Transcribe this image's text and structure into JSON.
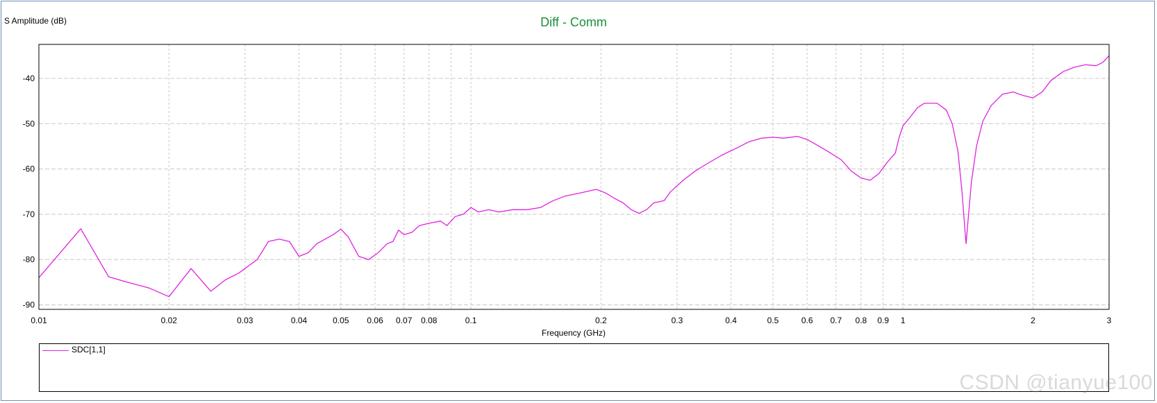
{
  "chart_data": {
    "type": "line",
    "title": "Diff - Comm",
    "ylabel": "S Amplitude (dB)",
    "xlabel": "Frequency (GHz)",
    "x_scale": "log",
    "xlim": [
      0.01,
      3
    ],
    "ylim": [
      -91,
      -32.5
    ],
    "grid": true,
    "x_ticks": [
      0.01,
      0.02,
      0.03,
      0.04,
      0.05,
      0.06,
      0.07,
      0.08,
      0.1,
      0.2,
      0.3,
      0.4,
      0.5,
      0.6,
      0.7,
      0.8,
      0.9,
      1,
      2,
      3
    ],
    "x_tick_labels": [
      "0.01",
      "0.02",
      "0.03",
      "0.04",
      "0.05",
      "0.06",
      "0.07",
      "0.08",
      "0.1",
      "0.2",
      "0.3",
      "0.4",
      "0.5",
      "0.6",
      "0.7",
      "0.8",
      "0.9",
      "1",
      "2",
      "3"
    ],
    "x_minor_grid": [
      0.09
    ],
    "y_ticks": [
      -90,
      -80,
      -70,
      -60,
      -50,
      -40
    ],
    "y_tick_labels": [
      "-90",
      "-80",
      "-70",
      "-60",
      "-50",
      "-40"
    ],
    "legend_position": "bottom",
    "series": [
      {
        "name": "SDC[1,1]",
        "color": "#e020e0",
        "points": [
          [
            0.01,
            -84
          ],
          [
            0.0125,
            -73.2
          ],
          [
            0.0145,
            -83.8
          ],
          [
            0.016,
            -85
          ],
          [
            0.018,
            -86.3
          ],
          [
            0.02,
            -88.2
          ],
          [
            0.0225,
            -82
          ],
          [
            0.025,
            -87
          ],
          [
            0.027,
            -84.5
          ],
          [
            0.029,
            -83
          ],
          [
            0.032,
            -80
          ],
          [
            0.034,
            -76
          ],
          [
            0.036,
            -75.5
          ],
          [
            0.038,
            -76
          ],
          [
            0.04,
            -79.3
          ],
          [
            0.042,
            -78.5
          ],
          [
            0.044,
            -76.5
          ],
          [
            0.048,
            -74.5
          ],
          [
            0.05,
            -73.3
          ],
          [
            0.052,
            -75
          ],
          [
            0.055,
            -79.3
          ],
          [
            0.058,
            -80
          ],
          [
            0.061,
            -78.5
          ],
          [
            0.064,
            -76.5
          ],
          [
            0.066,
            -76
          ],
          [
            0.068,
            -73.5
          ],
          [
            0.07,
            -74.5
          ],
          [
            0.073,
            -74
          ],
          [
            0.076,
            -72.5
          ],
          [
            0.08,
            -72
          ],
          [
            0.085,
            -71.5
          ],
          [
            0.088,
            -72.5
          ],
          [
            0.092,
            -70.5
          ],
          [
            0.096,
            -70
          ],
          [
            0.1,
            -68.5
          ],
          [
            0.104,
            -69.5
          ],
          [
            0.11,
            -69
          ],
          [
            0.116,
            -69.5
          ],
          [
            0.125,
            -69
          ],
          [
            0.135,
            -69
          ],
          [
            0.145,
            -68.5
          ],
          [
            0.155,
            -67
          ],
          [
            0.165,
            -66
          ],
          [
            0.175,
            -65.5
          ],
          [
            0.185,
            -65
          ],
          [
            0.195,
            -64.5
          ],
          [
            0.205,
            -65.3
          ],
          [
            0.215,
            -66.5
          ],
          [
            0.225,
            -67.5
          ],
          [
            0.235,
            -69
          ],
          [
            0.245,
            -69.8
          ],
          [
            0.255,
            -69
          ],
          [
            0.265,
            -67.5
          ],
          [
            0.28,
            -67
          ],
          [
            0.29,
            -65
          ],
          [
            0.31,
            -62.5
          ],
          [
            0.33,
            -60.5
          ],
          [
            0.35,
            -59
          ],
          [
            0.38,
            -57
          ],
          [
            0.41,
            -55.5
          ],
          [
            0.44,
            -54
          ],
          [
            0.47,
            -53.2
          ],
          [
            0.5,
            -53
          ],
          [
            0.53,
            -53.2
          ],
          [
            0.57,
            -52.8
          ],
          [
            0.6,
            -53.5
          ],
          [
            0.64,
            -55
          ],
          [
            0.68,
            -56.5
          ],
          [
            0.72,
            -58
          ],
          [
            0.76,
            -60.5
          ],
          [
            0.8,
            -62
          ],
          [
            0.84,
            -62.5
          ],
          [
            0.88,
            -61
          ],
          [
            0.92,
            -58.5
          ],
          [
            0.96,
            -56.5
          ],
          [
            0.98,
            -53
          ],
          [
            1.0,
            -50.5
          ],
          [
            1.04,
            -48.5
          ],
          [
            1.08,
            -46.5
          ],
          [
            1.12,
            -45.5
          ],
          [
            1.2,
            -45.5
          ],
          [
            1.26,
            -47
          ],
          [
            1.3,
            -50
          ],
          [
            1.34,
            -56
          ],
          [
            1.37,
            -65
          ],
          [
            1.39,
            -73
          ],
          [
            1.4,
            -76.5
          ],
          [
            1.41,
            -73
          ],
          [
            1.44,
            -63
          ],
          [
            1.48,
            -55
          ],
          [
            1.53,
            -49.5
          ],
          [
            1.6,
            -46
          ],
          [
            1.7,
            -43.5
          ],
          [
            1.8,
            -43
          ],
          [
            1.9,
            -43.8
          ],
          [
            2.0,
            -44.3
          ],
          [
            2.1,
            -43
          ],
          [
            2.2,
            -40.5
          ],
          [
            2.35,
            -38.5
          ],
          [
            2.5,
            -37.5
          ],
          [
            2.65,
            -37
          ],
          [
            2.8,
            -37.2
          ],
          [
            2.9,
            -36.5
          ],
          [
            3.0,
            -35
          ]
        ]
      }
    ]
  },
  "watermark": "CSDN @tianyue100"
}
